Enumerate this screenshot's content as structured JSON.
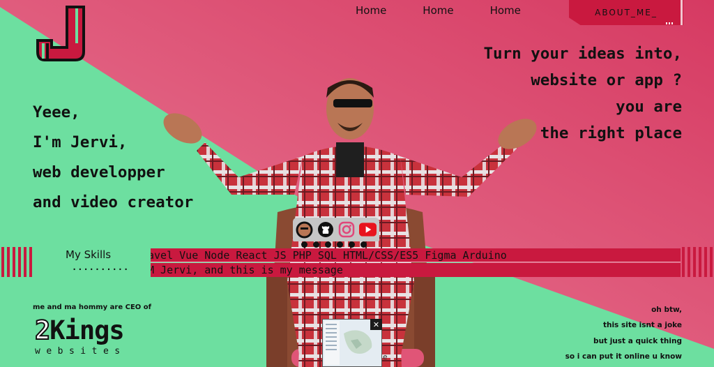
{
  "colors": {
    "pink": "#e05577",
    "green": "#6ddfa0",
    "crimson": "#c9193f"
  },
  "logo": {
    "icon": "j-logo-icon"
  },
  "nav": {
    "items": [
      "Home",
      "Home",
      "Home"
    ],
    "about": "ABOUT_ME_"
  },
  "hero_left": [
    "Yeee,",
    "I'm Jervi,",
    "web developper",
    "and video creator"
  ],
  "hero_right": [
    "Turn your ideas into,",
    "website or app ?",
    "you are",
    "in the right place"
  ],
  "social": {
    "icons": [
      "avatar-icon",
      "github-icon",
      "instagram-icon",
      "youtube-icon"
    ]
  },
  "skills": {
    "title": "My Skills",
    "dots": "..........",
    "marquee1": "avel Vue Node React JS PHP SQL HTML/CSS/ES5 Figma Arduino",
    "marquee2": "M Jervi, and this is my message"
  },
  "ceo": {
    "text": "me and ma hommy are CEO of",
    "brand_digit": "2",
    "brand_word": "Kings",
    "brand_sub": "websites"
  },
  "notes": [
    "oh btw,",
    "this site isnt a joke",
    "but just a quick thing",
    "so i can put it online u know"
  ],
  "popup": {
    "close": "✕",
    "tail": "e"
  }
}
